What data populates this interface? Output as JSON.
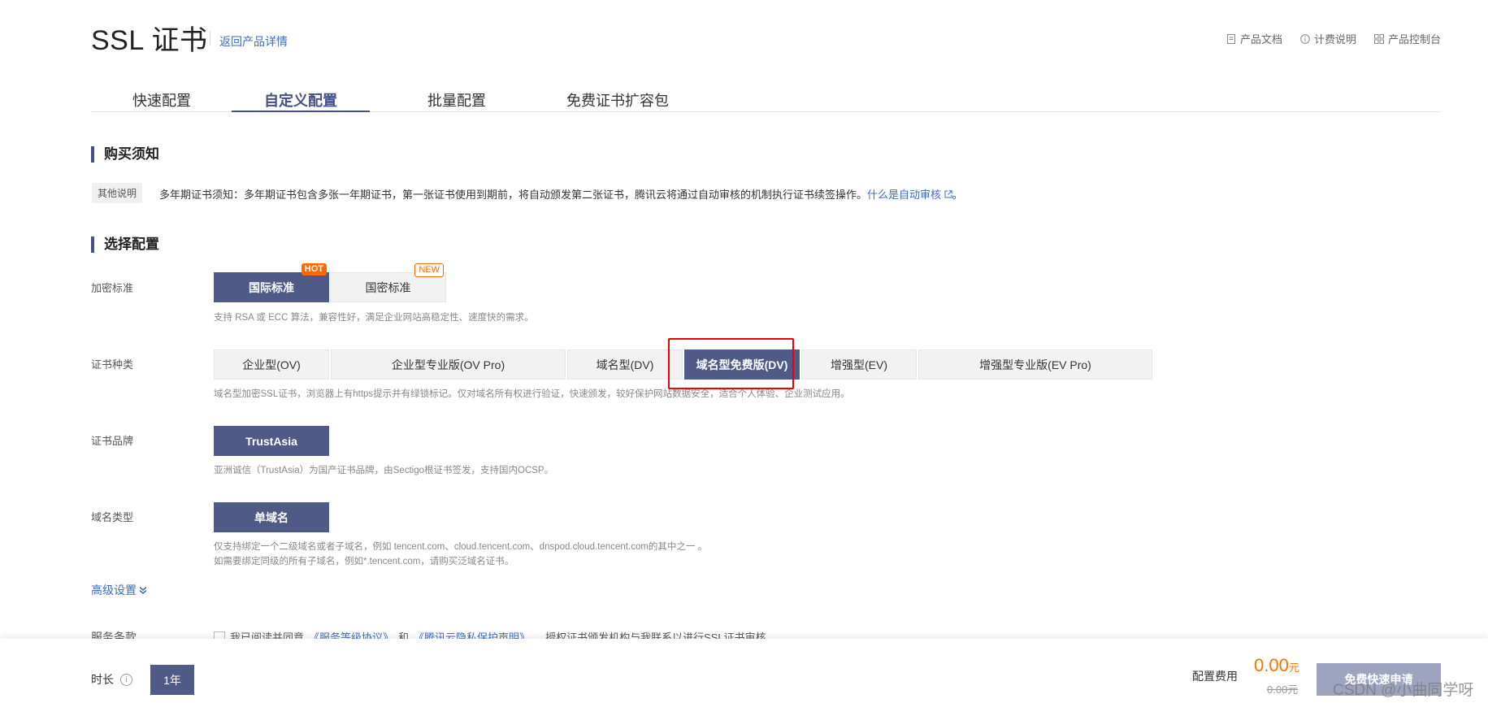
{
  "header": {
    "title": "SSL 证书",
    "back_link": "返回产品详情",
    "links": [
      "产品文档",
      "计费说明",
      "产品控制台"
    ]
  },
  "tabs": [
    "快速配置",
    "自定义配置",
    "批量配置",
    "免费证书扩容包"
  ],
  "active_tab": "自定义配置",
  "notice": {
    "section_title": "购买须知",
    "tag": "其他说明",
    "text": "多年期证书须知：多年期证书包含多张一年期证书，第一张证书使用到期前，将自动颁发第二张证书，腾讯云将通过自动审核的机制执行证书续签操作。",
    "link": "什么是自动审核",
    "tail": "。"
  },
  "config": {
    "section_title": "选择配置",
    "encryption": {
      "label": "加密标准",
      "options": [
        "国际标准",
        "国密标准"
      ],
      "selected": "国际标准",
      "badges": [
        "HOT",
        "NEW"
      ],
      "hint": "支持 RSA 或 ECC 算法，兼容性好，满足企业网站高稳定性、速度快的需求。"
    },
    "cert_type": {
      "label": "证书种类",
      "options": [
        "企业型(OV)",
        "企业型专业版(OV Pro)",
        "域名型(DV)",
        "域名型免费版(DV)",
        "增强型(EV)",
        "增强型专业版(EV Pro)"
      ],
      "selected": "域名型免费版(DV)",
      "hint": "域名型加密SSL证书，浏览器上有https提示并有绿锁标记。仅对域名所有权进行验证，快速颁发，较好保护网站数据安全，适合个人体验、企业测试应用。"
    },
    "brand": {
      "label": "证书品牌",
      "options": [
        "TrustAsia"
      ],
      "selected": "TrustAsia",
      "hint": "亚洲诚信（TrustAsia）为国产证书品牌，由Sectigo根证书签发，支持国内OCSP。"
    },
    "domain_type": {
      "label": "域名类型",
      "options": [
        "单域名"
      ],
      "selected": "单域名",
      "hint_1": "仅支持绑定一个二级域名或者子域名，例如 tencent.com、cloud.tencent.com、dnspod.cloud.tencent.com的其中之一 。",
      "hint_2": "如需要绑定同级的所有子域名，例如*.tencent.com，请购买泛域名证书。"
    },
    "advanced": "高级设置",
    "terms": {
      "label": "服务条款",
      "prefix": "我已阅读并同意",
      "link1": "《服务等级协议》",
      "and": "和",
      "link2": "《腾讯云隐私保护声明》",
      "suffix": "，授权证书颁发机构与我联系以进行SSL证书审核",
      "checked": false
    }
  },
  "bottom_bar": {
    "duration_label": "时长",
    "duration_value": "1年",
    "fee_label": "配置费用",
    "price": "0.00",
    "price_unit": "元",
    "original_price": "0.00元",
    "apply_button": "免费快速申请",
    "watermark": "CSDN @小曲同学呀"
  },
  "colors": {
    "primary": "#4f5a87",
    "link": "#3f6bc5",
    "price": "#ff7200",
    "highlight": "#e00000"
  }
}
